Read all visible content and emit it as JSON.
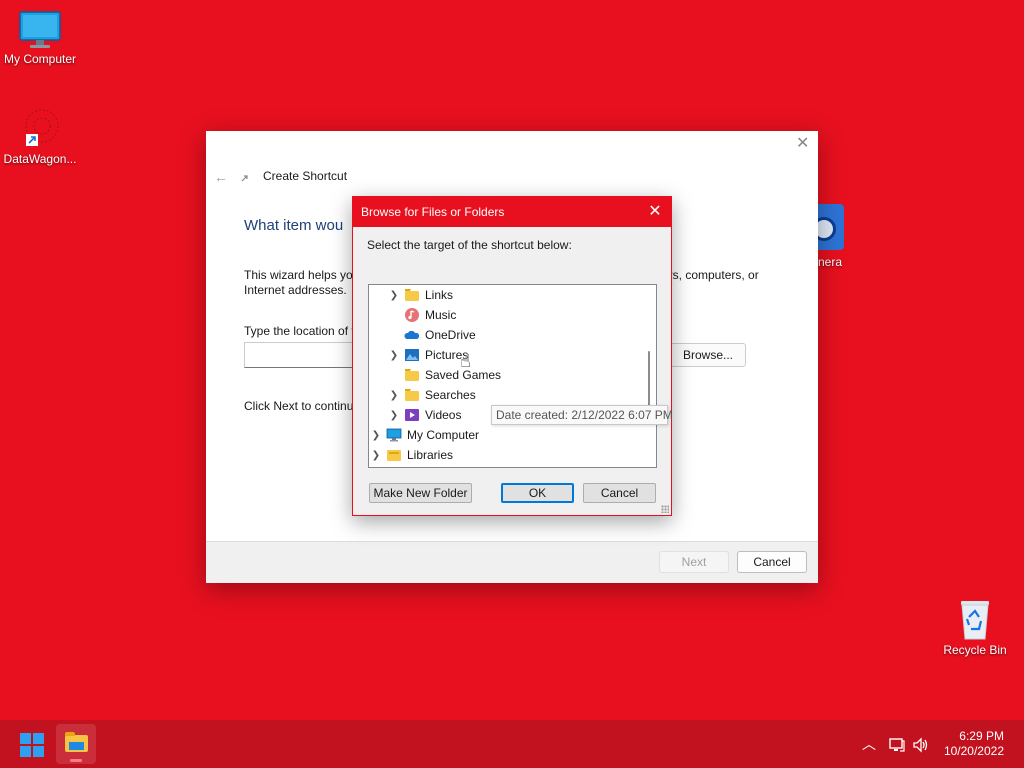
{
  "desktop": {
    "icons": [
      {
        "label": "My Computer"
      },
      {
        "label": "DataWagon..."
      },
      {
        "label": "nera"
      },
      {
        "label": "Recycle Bin"
      }
    ]
  },
  "wizard": {
    "title": "Create Shortcut",
    "heading": "What item wou",
    "description_left": "This wizard helps you\nInternet addresses.",
    "description_right": "ers, computers, or",
    "location_label": "Type the location of t",
    "browse_label": "Browse...",
    "next_hint": "Click Next to continu",
    "next_label": "Next",
    "cancel_label": "Cancel"
  },
  "browse_dialog": {
    "title": "Browse for Files or Folders",
    "instruction": "Select the target of the shortcut below:",
    "tree": [
      {
        "label": "Links",
        "expandable": true,
        "icon": "folder-icon",
        "level": 1
      },
      {
        "label": "Music",
        "expandable": false,
        "icon": "music-icon",
        "level": 1
      },
      {
        "label": "OneDrive",
        "expandable": false,
        "icon": "cloud-icon",
        "level": 1
      },
      {
        "label": "Pictures",
        "expandable": true,
        "icon": "pictures-icon",
        "level": 1
      },
      {
        "label": "Saved Games",
        "expandable": false,
        "icon": "folder-icon",
        "level": 1
      },
      {
        "label": "Searches",
        "expandable": true,
        "icon": "folder-icon",
        "level": 1
      },
      {
        "label": "Videos",
        "expandable": true,
        "icon": "videos-icon",
        "level": 1
      },
      {
        "label": "My Computer",
        "expandable": true,
        "icon": "computer-icon",
        "level": 0
      },
      {
        "label": "Libraries",
        "expandable": true,
        "icon": "libraries-icon",
        "level": 0
      }
    ],
    "tooltip": "Date created: 2/12/2022 6:07 PM",
    "make_folder_label": "Make New Folder",
    "ok_label": "OK",
    "cancel_label": "Cancel"
  },
  "taskbar": {
    "time": "6:29 PM",
    "date": "10/20/2022"
  },
  "colors": {
    "desktop_bg": "#e8101f",
    "taskbar_bg": "#c3121f",
    "accent": "#0078d7"
  }
}
